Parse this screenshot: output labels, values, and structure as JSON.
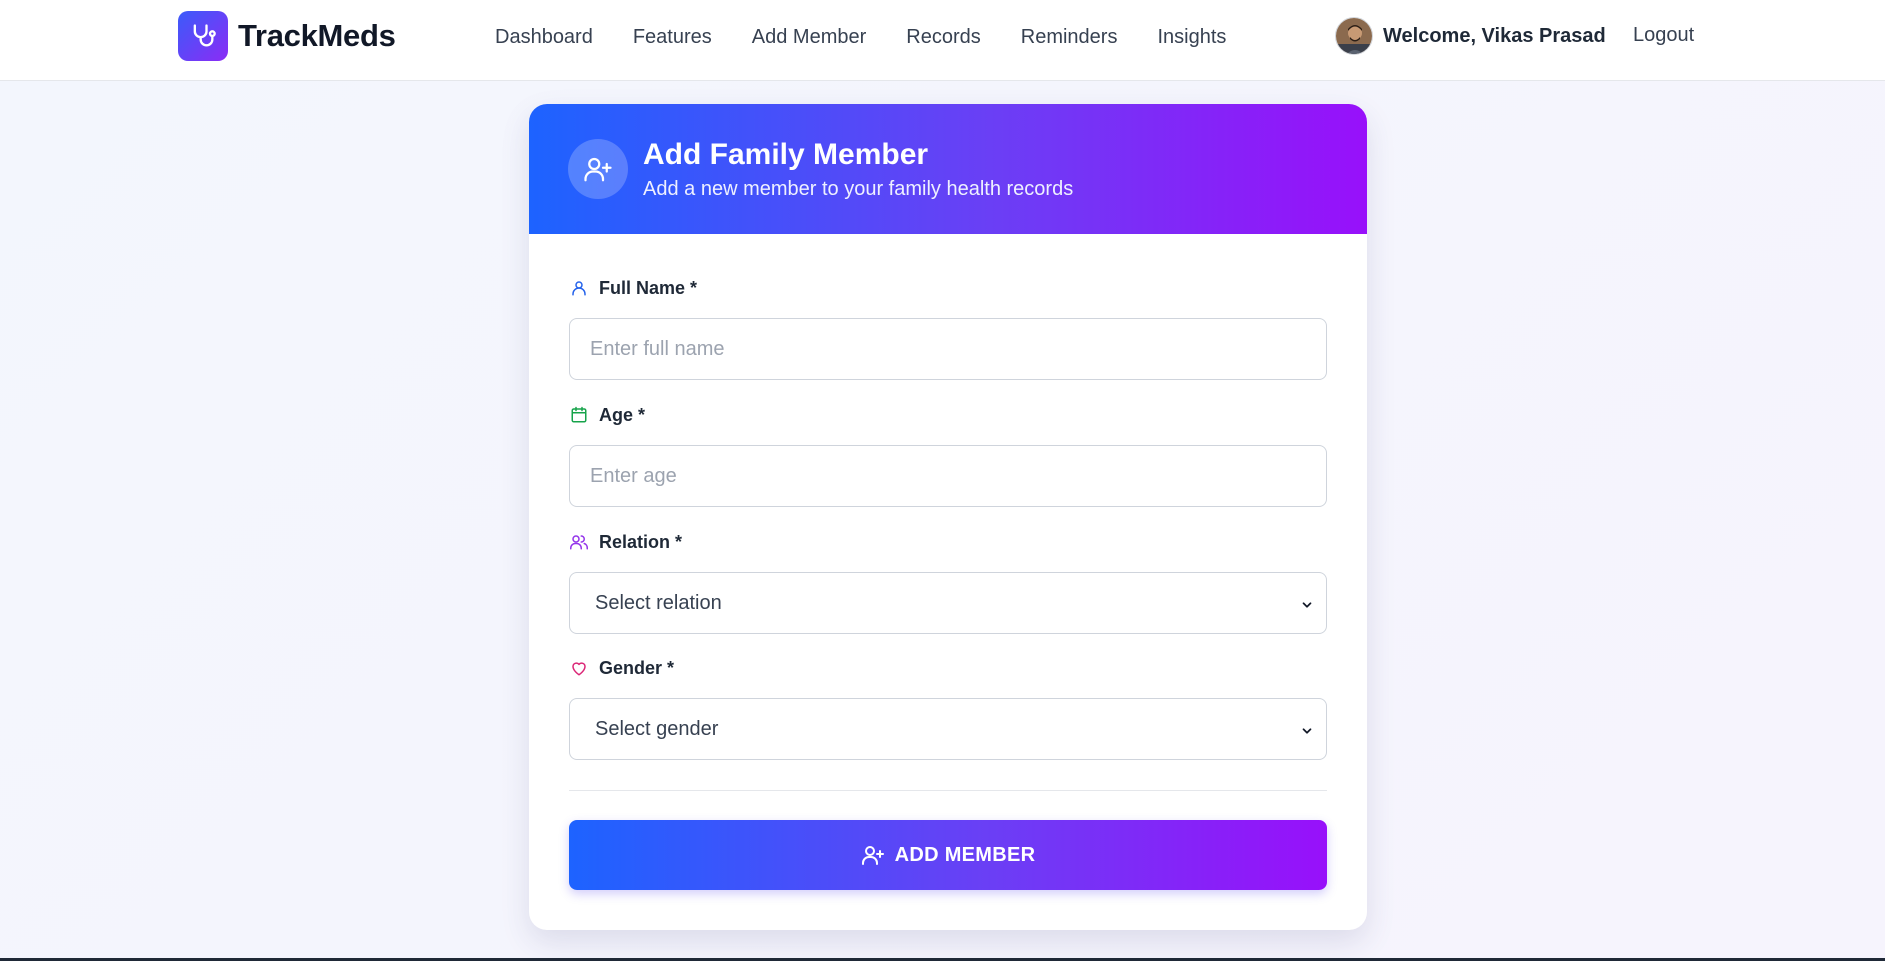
{
  "app": {
    "name": "TrackMeds"
  },
  "nav": {
    "links": [
      "Dashboard",
      "Features",
      "Add Member",
      "Records",
      "Reminders",
      "Insights"
    ],
    "welcome": "Welcome, Vikas Prasad",
    "logout": "Logout"
  },
  "form": {
    "title": "Add Family Member",
    "subtitle": "Add a new member to your family health records",
    "fields": {
      "name": {
        "label": "Full Name *",
        "placeholder": "Enter full name",
        "icon": "user-icon",
        "icon_color": "#2563eb"
      },
      "age": {
        "label": "Age *",
        "placeholder": "Enter age",
        "icon": "calendar-icon",
        "icon_color": "#16a34a"
      },
      "relation": {
        "label": "Relation *",
        "value": "Select relation",
        "icon": "users-icon",
        "icon_color": "#9333ea"
      },
      "gender": {
        "label": "Gender *",
        "value": "Select gender",
        "icon": "heart-icon",
        "icon_color": "#db2777"
      }
    },
    "submit_label": "ADD MEMBER"
  },
  "colors": {
    "gradient_start": "#1d63ff",
    "gradient_end": "#9810fa",
    "brand_logo_start": "#3b5bfa",
    "brand_logo_end": "#8b2cf5"
  }
}
